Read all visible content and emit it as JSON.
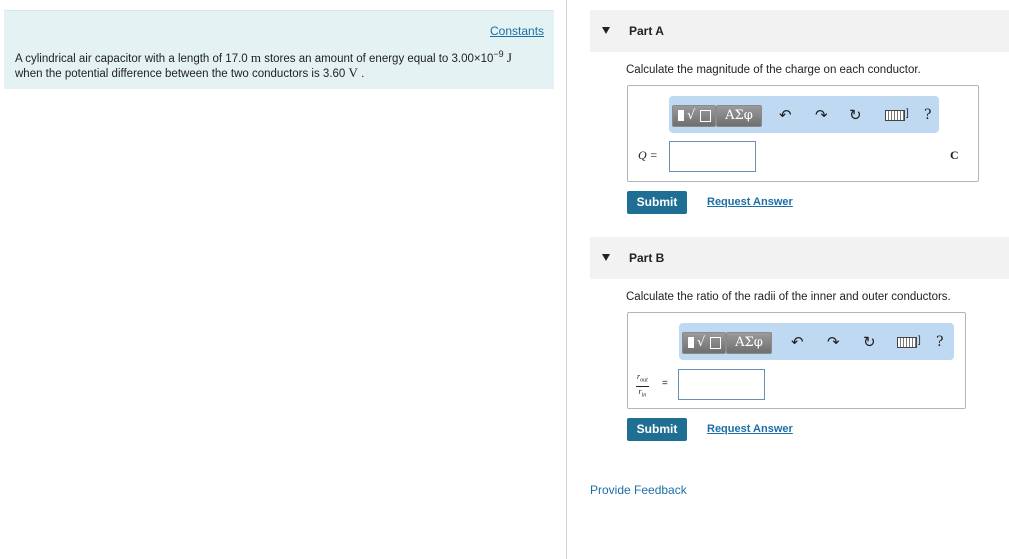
{
  "problem": {
    "constants_link": "Constants",
    "text_part1": "A cylindrical air capacitor with a length of 17.0 ",
    "unit_m": "m",
    "text_part2": " stores an amount of energy equal to 3.00×10",
    "exponent": "−9",
    "unit_J": "J",
    "text_line2": "when the potential difference between the two conductors is 3.60 ",
    "unit_V": "V",
    "text_period": " ."
  },
  "toolbar": {
    "symbols_label": "ΑΣφ",
    "undo_icon": "undo-icon",
    "redo_icon": "redo-icon",
    "reset_icon": "reset-icon",
    "keyboard_icon": "keyboard-icon",
    "help_label": "?"
  },
  "part_a": {
    "title": "Part A",
    "prompt": "Calculate the magnitude of the charge on each conductor.",
    "variable": "Q =",
    "input_value": "",
    "units": "C",
    "submit_label": "Submit",
    "request_label": "Request Answer"
  },
  "part_b": {
    "title": "Part B",
    "prompt": "Calculate the ratio of the radii of the inner and outer conductors.",
    "numerator": "r",
    "numerator_sub": "out",
    "denominator": "r",
    "denominator_sub": "in",
    "equals": "=",
    "input_value": "",
    "submit_label": "Submit",
    "request_label": "Request Answer"
  },
  "feedback_label": "Provide Feedback"
}
